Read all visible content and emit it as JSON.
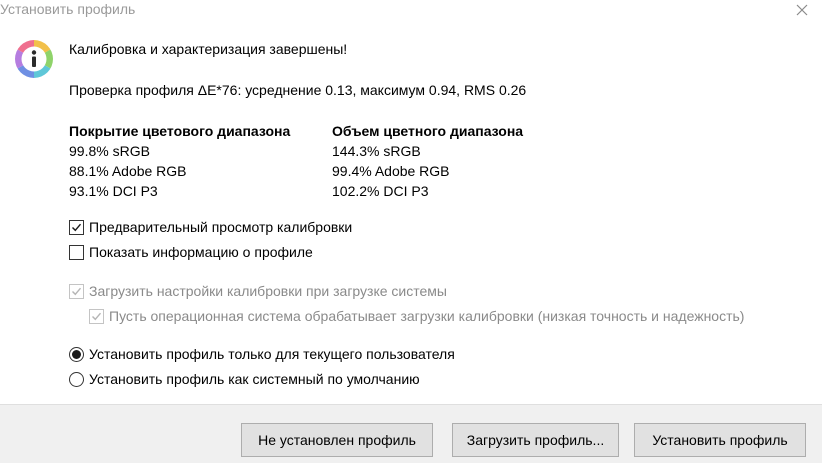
{
  "window": {
    "title": "Установить профиль",
    "close_symbol": "×"
  },
  "icon": "info-icon",
  "message": {
    "headline": "Калибровка и характеризация завершены!",
    "verification": "Проверка профиля ΔE*76: усреднение 0.13, максимум 0.94, RMS 0.26"
  },
  "gamut": {
    "coverage": {
      "title": "Покрытие цветового диапазона",
      "rows": [
        "99.8% sRGB",
        "88.1% Adobe RGB",
        "93.1% DCI P3"
      ]
    },
    "volume": {
      "title": "Объем цветного диапазона",
      "rows": [
        "144.3% sRGB",
        "99.4% Adobe RGB",
        "102.2% DCI P3"
      ]
    }
  },
  "options": {
    "preview_calibration": {
      "label": "Предварительный просмотр калибровки",
      "checked": true,
      "enabled": true
    },
    "show_profile_info": {
      "label": "Показать информацию о профиле",
      "checked": false,
      "enabled": true
    },
    "load_calibration_on_startup": {
      "label": "Загрузить настройки калибровки при загрузке системы",
      "checked": true,
      "enabled": false
    },
    "os_handles_calibration": {
      "label": "Пусть операционная система обрабатывает загрузки калибровки (низкая точность и надежность)",
      "checked": true,
      "enabled": false
    }
  },
  "install_scope": {
    "selected": "current_user",
    "current_user": "Установить профиль только для текущего пользователя",
    "system_default": "Установить профиль как системный по умолчанию"
  },
  "buttons": {
    "not_installed": "Не установлен профиль",
    "load_profile": "Загрузить профиль...",
    "install_profile": "Установить профиль"
  },
  "colors": {
    "footer_bg": "#f0f0f0",
    "button_bg": "#e1e1e1",
    "disabled_text": "#8a8a8a"
  }
}
